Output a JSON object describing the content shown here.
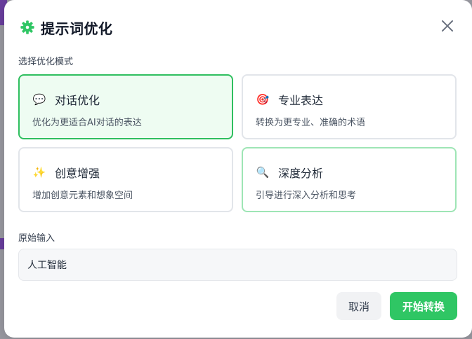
{
  "dialog": {
    "title": "提示词优化",
    "mode_section_label": "选择优化模式",
    "input_section_label": "原始输入",
    "accent_color": "#2fc664"
  },
  "modes": [
    {
      "icon": "speech-bubble",
      "emoji": "💬",
      "title": "对话优化",
      "description": "优化为更适合AI对话的表达",
      "state": "selected"
    },
    {
      "icon": "target",
      "emoji": "🎯",
      "title": "专业表达",
      "description": "转换为更专业、准确的术语",
      "state": "default"
    },
    {
      "icon": "sparkles",
      "emoji": "✨",
      "title": "创意增强",
      "description": "增加创意元素和想象空间",
      "state": "default"
    },
    {
      "icon": "magnifier",
      "emoji": "🔍",
      "title": "深度分析",
      "description": "引导进行深入分析和思考",
      "state": "hover"
    }
  ],
  "input": {
    "value": "人工智能"
  },
  "buttons": {
    "cancel_label": "取消",
    "start_label": "开始转换"
  }
}
